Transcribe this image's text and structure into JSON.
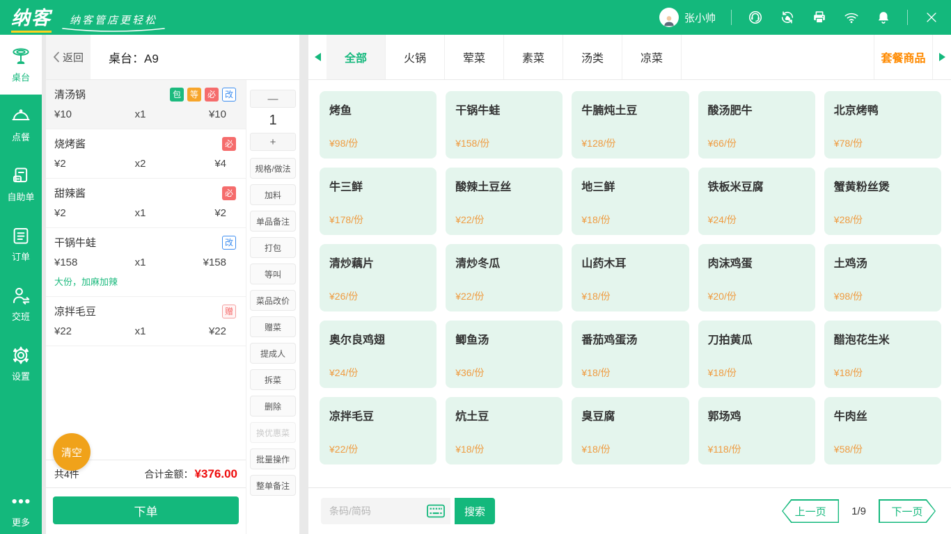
{
  "colors": {
    "accent_green": "#14b87c",
    "combo_orange": "#ff8a00",
    "price_orange": "#ef9b40",
    "total_red": "#ee0b0b",
    "badge_red": "#f56c6c",
    "badge_orange": "#f7a52a",
    "badge_blue": "#3d8ef0",
    "card_bg": "#e4f5ed",
    "clear_amber": "#f0a21a"
  },
  "topbar": {
    "logo_text": "纳客",
    "slogan": "纳客管店更轻松",
    "user_name": "张小帅",
    "icons": [
      "support-headset-icon",
      "cloud-sync-icon",
      "printer-icon",
      "wifi-icon",
      "bell-icon",
      "close-icon"
    ]
  },
  "sidebar": {
    "items": [
      {
        "label": "桌台",
        "icon": "table-icon",
        "active": true
      },
      {
        "label": "点餐",
        "icon": "cloche-icon",
        "active": false
      },
      {
        "label": "自助单",
        "icon": "self-order-doc-icon",
        "active": false
      },
      {
        "label": "订单",
        "icon": "clipboard-icon",
        "active": false
      },
      {
        "label": "交班",
        "icon": "shift-person-icon",
        "active": false
      },
      {
        "label": "设置",
        "icon": "gear-icon",
        "active": false
      }
    ],
    "more_label": "更多"
  },
  "header": {
    "back_label": "返回",
    "table_title": "桌台：A9"
  },
  "tabs": {
    "items": [
      {
        "label": "全部",
        "selected": true
      },
      {
        "label": "火锅",
        "selected": false
      },
      {
        "label": "荤菜",
        "selected": false
      },
      {
        "label": "素菜",
        "selected": false
      },
      {
        "label": "汤类",
        "selected": false
      },
      {
        "label": "凉菜",
        "selected": false
      }
    ],
    "combo_label": "套餐商品"
  },
  "order": {
    "items": [
      {
        "name": "清汤锅",
        "badges": [
          {
            "text": "包"
          },
          {
            "text": "等"
          },
          {
            "text": "必"
          },
          {
            "text": "改"
          }
        ],
        "price": "¥10",
        "qty": "x1",
        "amount": "¥10",
        "note": ""
      },
      {
        "name": "烧烤酱",
        "badges": [
          {
            "text": "必"
          }
        ],
        "price": "¥2",
        "qty": "x2",
        "amount": "¥4",
        "note": ""
      },
      {
        "name": "甜辣酱",
        "badges": [
          {
            "text": "必"
          }
        ],
        "price": "¥2",
        "qty": "x1",
        "amount": "¥2",
        "note": ""
      },
      {
        "name": "干锅牛蛙",
        "badges": [
          {
            "text": "改"
          }
        ],
        "price": "¥158",
        "qty": "x1",
        "amount": "¥158",
        "note": "大份，加麻加辣"
      },
      {
        "name": "凉拌毛豆",
        "badges": [
          {
            "text": "赠"
          }
        ],
        "price": "¥22",
        "qty": "x1",
        "amount": "¥22",
        "note": ""
      }
    ],
    "clear_label": "清空",
    "total_count": "共4件",
    "total_label": "合计金额：",
    "total_amount": "¥376.00",
    "submit_label": "下单"
  },
  "actions": {
    "minus": "—",
    "quantity": "1",
    "plus": "+",
    "buttons": [
      {
        "label": "规格/做法"
      },
      {
        "label": "加料"
      },
      {
        "label": "单品备注"
      },
      {
        "label": "打包"
      },
      {
        "label": "等叫"
      },
      {
        "label": "菜品改价"
      },
      {
        "label": "赠菜"
      },
      {
        "label": "提成人"
      },
      {
        "label": "拆菜"
      },
      {
        "label": "删除"
      },
      {
        "label": "换优惠菜",
        "disabled": true
      },
      {
        "label": "批量操作"
      },
      {
        "label": "整单备注"
      }
    ]
  },
  "menu": {
    "items": [
      {
        "name": "烤鱼",
        "price": "¥98/份"
      },
      {
        "name": "干锅牛蛙",
        "price": "¥158/份"
      },
      {
        "name": "牛腩炖土豆",
        "price": "¥128/份"
      },
      {
        "name": "酸汤肥牛",
        "price": "¥66/份"
      },
      {
        "name": "北京烤鸭",
        "price": "¥78/份"
      },
      {
        "name": "牛三鲜",
        "price": "¥178/份"
      },
      {
        "name": "酸辣土豆丝",
        "price": "¥22/份"
      },
      {
        "name": "地三鲜",
        "price": "¥18/份"
      },
      {
        "name": "铁板米豆腐",
        "price": "¥24/份"
      },
      {
        "name": "蟹黄粉丝煲",
        "price": "¥28/份"
      },
      {
        "name": "清炒藕片",
        "price": "¥26/份"
      },
      {
        "name": "清炒冬瓜",
        "price": "¥22/份"
      },
      {
        "name": "山药木耳",
        "price": "¥18/份"
      },
      {
        "name": "肉沫鸡蛋",
        "price": "¥20/份"
      },
      {
        "name": "土鸡汤",
        "price": "¥98/份"
      },
      {
        "name": "奥尔良鸡翅",
        "price": "¥24/份"
      },
      {
        "name": "鲫鱼汤",
        "price": "¥36/份"
      },
      {
        "name": "番茄鸡蛋汤",
        "price": "¥18/份"
      },
      {
        "name": "刀拍黄瓜",
        "price": "¥18/份"
      },
      {
        "name": "醋泡花生米",
        "price": "¥18/份"
      },
      {
        "name": "凉拌毛豆",
        "price": "¥22/份"
      },
      {
        "name": "炕土豆",
        "price": "¥18/份"
      },
      {
        "name": "臭豆腐",
        "price": "¥18/份"
      },
      {
        "name": "郭场鸡",
        "price": "¥118/份"
      },
      {
        "name": "牛肉丝",
        "price": "¥58/份"
      }
    ]
  },
  "footer": {
    "search_placeholder": "条码/简码",
    "search_label": "搜索",
    "prev_label": "上一页",
    "page_indicator": "1/9",
    "next_label": "下一页"
  }
}
